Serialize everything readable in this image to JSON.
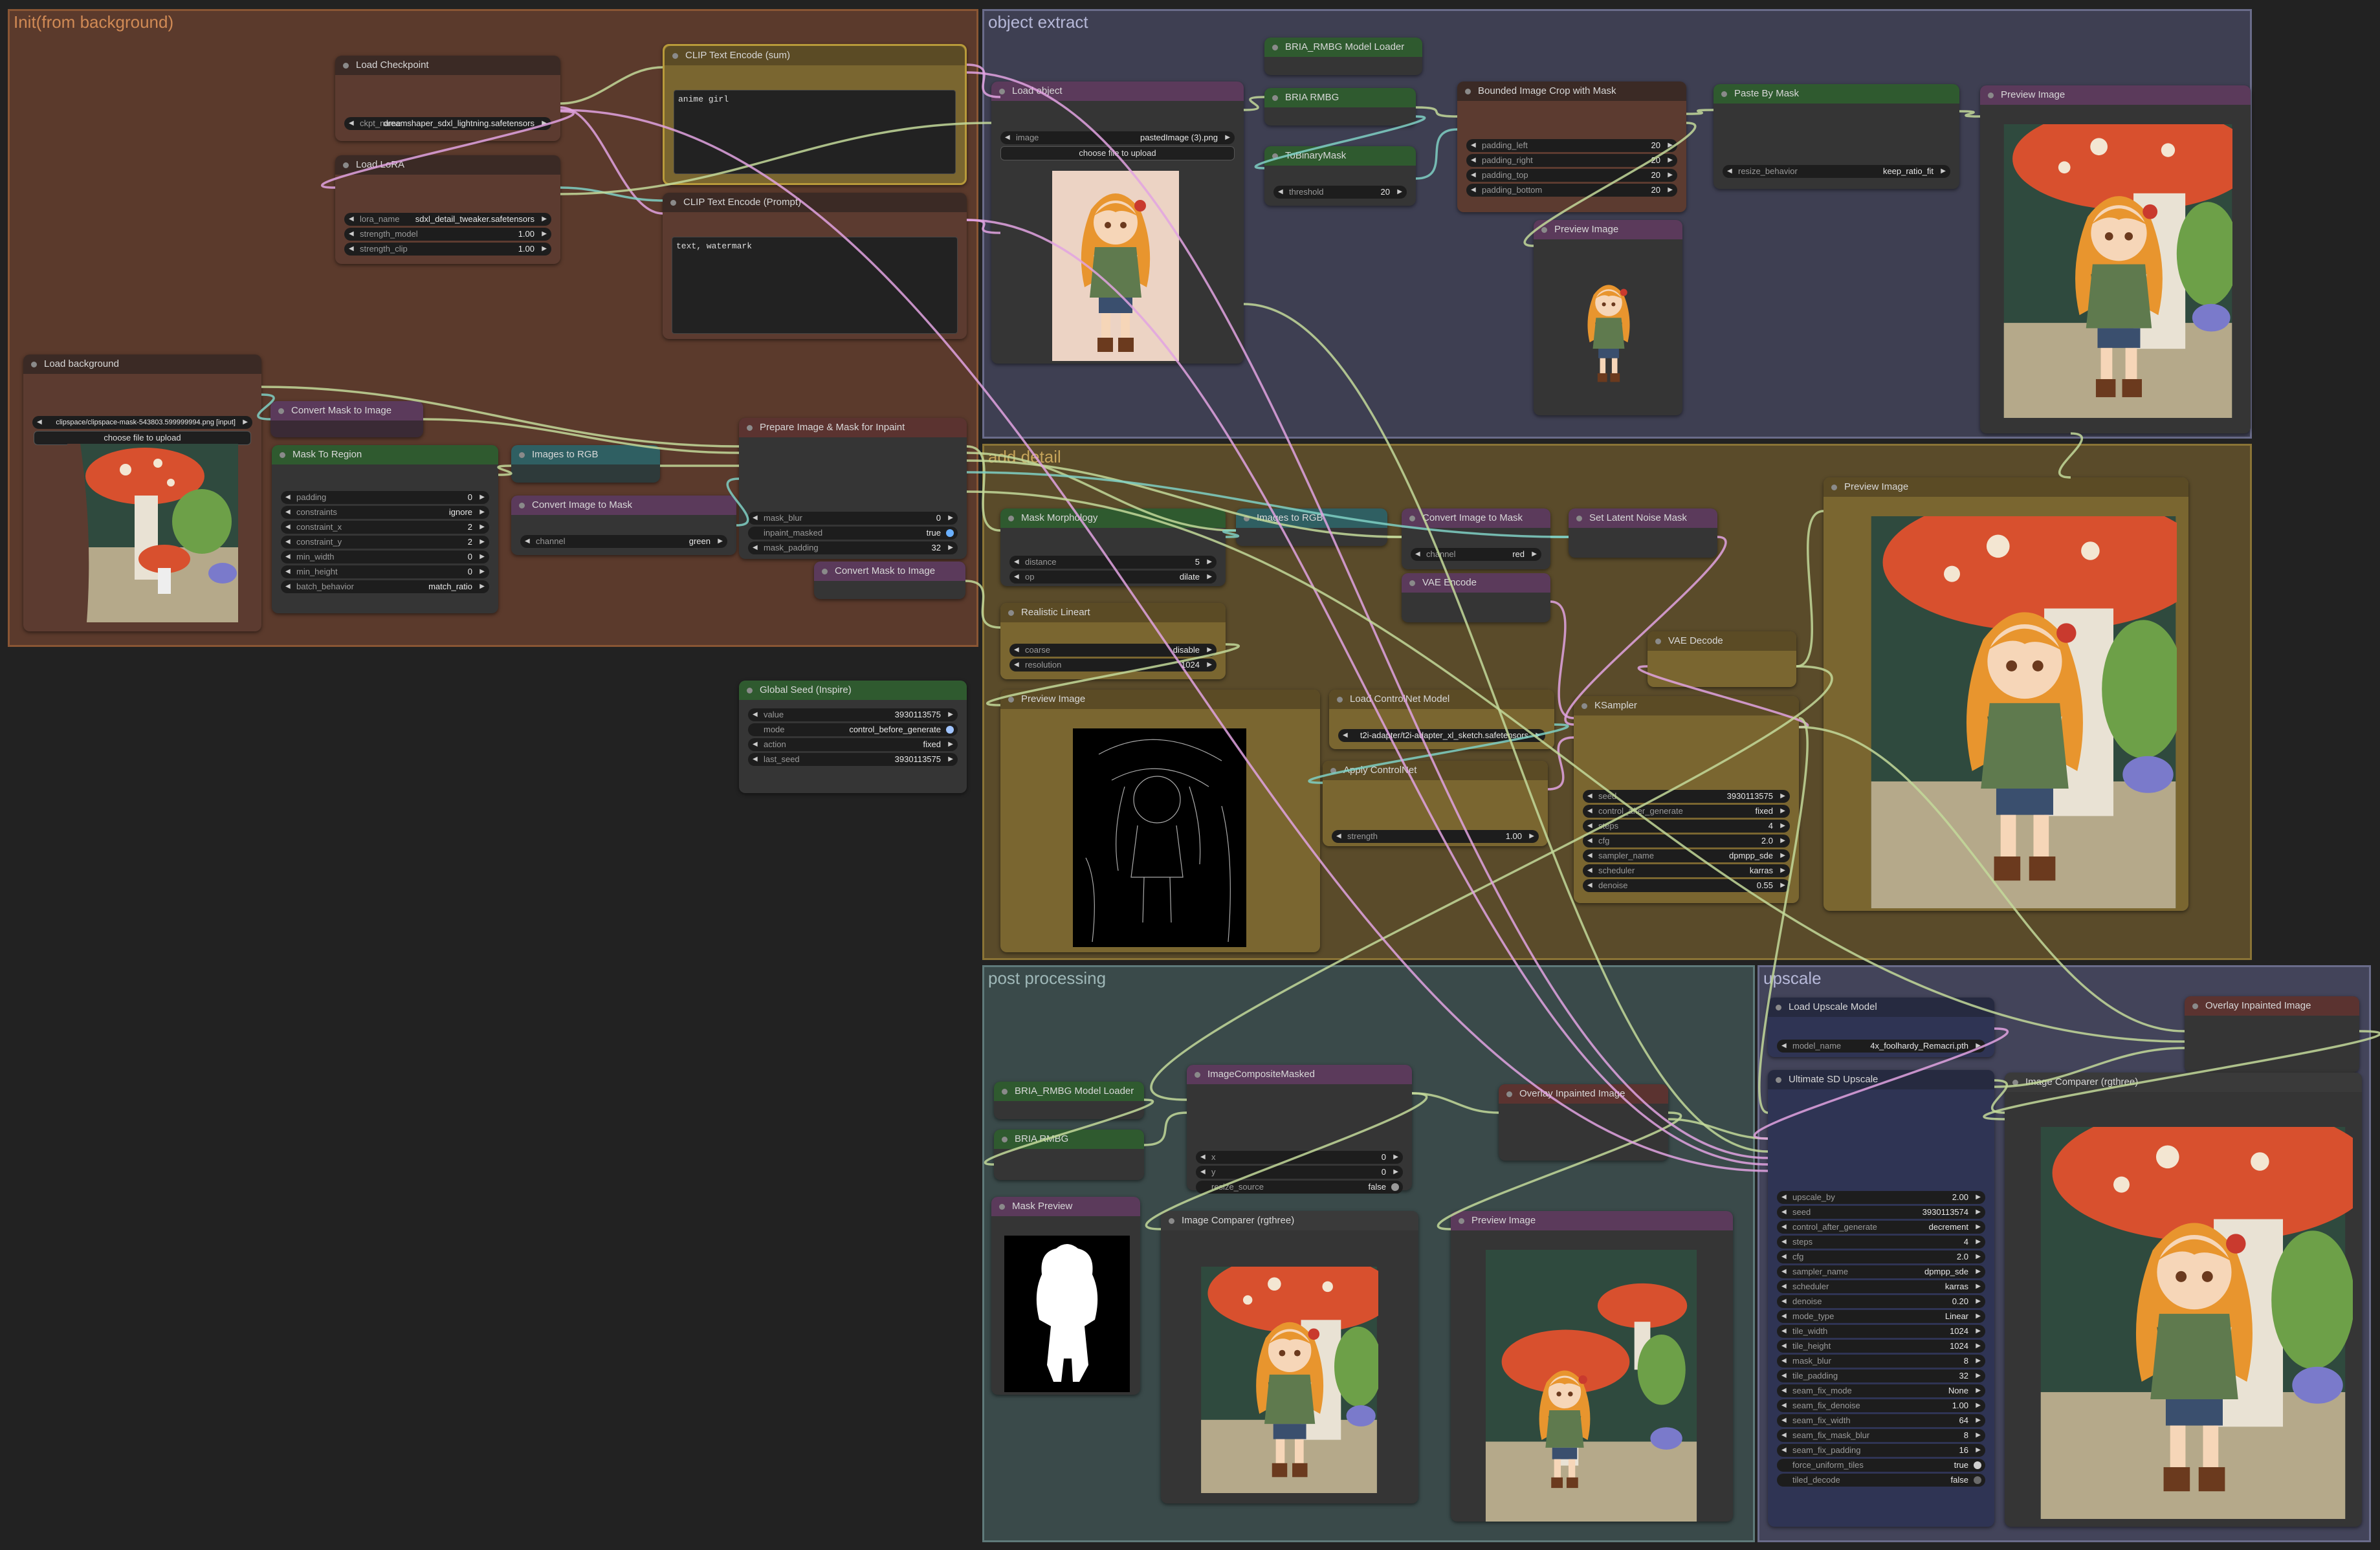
{
  "groups": {
    "init": "Init(from background)",
    "object_extract": "object extract",
    "add_detail": "add detail",
    "post_processing": "post processing",
    "upscale": "upscale"
  },
  "nodes": {
    "load_checkpoint": {
      "title": "Load Checkpoint",
      "ckpt_name_key": "ckpt_name",
      "ckpt_name": "dreamshaper_sdxl_lightning.safetensors"
    },
    "clip_sum": {
      "title": "CLIP Text Encode (sum)",
      "text": "anime girl"
    },
    "clip_prompt": {
      "title": "CLIP Text Encode (Prompt)",
      "text": "text, watermark"
    },
    "load_lora": {
      "title": "Load LoRA",
      "lora_name_key": "lora_name",
      "lora_name": "sdxl_detail_tweaker.safetensors",
      "strength_model_key": "strength_model",
      "strength_model": "1.00",
      "strength_clip_key": "strength_clip",
      "strength_clip": "1.00"
    },
    "load_background": {
      "title": "Load background",
      "image": "clipspace/clipspace-mask-543803.599999994.png [input]",
      "upload": "choose file to upload"
    },
    "convert_mask_to_image_1": {
      "title": "Convert Mask to Image"
    },
    "mask_to_region": {
      "title": "Mask To Region",
      "widgets": [
        [
          "padding",
          "0"
        ],
        [
          "constraints",
          "ignore"
        ],
        [
          "constraint_x",
          "2"
        ],
        [
          "constraint_y",
          "2"
        ],
        [
          "min_width",
          "0"
        ],
        [
          "min_height",
          "0"
        ],
        [
          "batch_behavior",
          "match_ratio"
        ]
      ]
    },
    "images_to_rgb_1": {
      "title": "Images to RGB"
    },
    "convert_image_to_mask_1": {
      "title": "Convert Image to Mask",
      "channel_key": "channel",
      "channel": "green"
    },
    "prepare_inpaint": {
      "title": "Prepare Image & Mask for Inpaint",
      "mask_blur_key": "mask_blur",
      "mask_blur": "0",
      "inpaint_masked_key": "inpaint_masked",
      "inpaint_masked": "true",
      "mask_padding_key": "mask_padding",
      "mask_padding": "32"
    },
    "convert_mask_to_image_2": {
      "title": "Convert Mask to Image"
    },
    "global_seed": {
      "title": "Global Seed (Inspire)",
      "widgets": [
        [
          "value",
          "3930113575"
        ],
        [
          "mode",
          "control_before_generate"
        ],
        [
          "action",
          "fixed"
        ],
        [
          "last_seed",
          "3930113575"
        ]
      ]
    },
    "load_object": {
      "title": "Load object",
      "image_key": "image",
      "image": "pastedImage (3).png",
      "upload": "choose file to upload"
    },
    "bria_loader_1": {
      "title": "BRIA_RMBG Model Loader"
    },
    "bria_rmbg_1": {
      "title": "BRIA RMBG"
    },
    "to_binary_mask": {
      "title": "ToBinaryMask",
      "threshold_key": "threshold",
      "threshold": "20"
    },
    "bounded_crop": {
      "title": "Bounded Image Crop with Mask",
      "widgets": [
        [
          "padding_left",
          "20"
        ],
        [
          "padding_right",
          "20"
        ],
        [
          "padding_top",
          "20"
        ],
        [
          "padding_bottom",
          "20"
        ]
      ]
    },
    "preview_crop": {
      "title": "Preview Image"
    },
    "paste_by_mask": {
      "title": "Paste By Mask",
      "resize_behavior_key": "resize_behavior",
      "resize_behavior": "keep_ratio_fit"
    },
    "preview_paste": {
      "title": "Preview Image"
    },
    "mask_morphology": {
      "title": "Mask Morphology",
      "distance_key": "distance",
      "distance": "5",
      "op_key": "op",
      "op": "dilate"
    },
    "images_to_rgb_2": {
      "title": "Images to RGB"
    },
    "convert_image_to_mask_2": {
      "title": "Convert Image to Mask",
      "channel_key": "channel",
      "channel": "red"
    },
    "set_latent_noise_mask": {
      "title": "Set Latent Noise Mask"
    },
    "vae_encode": {
      "title": "VAE Encode"
    },
    "realistic_lineart": {
      "title": "Realistic Lineart",
      "coarse_key": "coarse",
      "coarse": "disable",
      "resolution_key": "resolution",
      "resolution": "1024"
    },
    "preview_lineart": {
      "title": "Preview Image"
    },
    "load_controlnet": {
      "title": "Load ControlNet Model",
      "control_net_name": "t2i-adapter/t2i-adapter_xl_sketch.safetensors"
    },
    "apply_controlnet": {
      "title": "Apply ControlNet",
      "strength_key": "strength",
      "strength": "1.00"
    },
    "vae_decode": {
      "title": "VAE Decode"
    },
    "ksampler": {
      "title": "KSampler",
      "widgets": [
        [
          "seed",
          "3930113575"
        ],
        [
          "control_after_generate",
          "fixed"
        ],
        [
          "steps",
          "4"
        ],
        [
          "cfg",
          "2.0"
        ],
        [
          "sampler_name",
          "dpmpp_sde"
        ],
        [
          "scheduler",
          "karras"
        ],
        [
          "denoise",
          "0.55"
        ]
      ]
    },
    "preview_detail": {
      "title": "Preview Image"
    },
    "bria_loader_2": {
      "title": "BRIA_RMBG Model Loader"
    },
    "bria_rmbg_2": {
      "title": "BRIA RMBG"
    },
    "mask_preview": {
      "title": "Mask Preview"
    },
    "image_composite": {
      "title": "ImageCompositeMasked",
      "x_key": "x",
      "x": "0",
      "y_key": "y",
      "y": "0",
      "resize_source_key": "resize_source",
      "resize_source": "false"
    },
    "image_comparer_1": {
      "title": "Image Comparer (rgthree)"
    },
    "overlay_1": {
      "title": "Overlay Inpainted Image"
    },
    "preview_post": {
      "title": "Preview Image"
    },
    "load_upscale_model": {
      "title": "Load Upscale Model",
      "model_name_key": "model_name",
      "model_name": "4x_foolhardy_Remacri.pth"
    },
    "ultimate_sd_upscale": {
      "title": "Ultimate SD Upscale",
      "widgets": [
        [
          "upscale_by",
          "2.00"
        ],
        [
          "seed",
          "3930113574"
        ],
        [
          "control_after_generate",
          "decrement"
        ],
        [
          "steps",
          "4"
        ],
        [
          "cfg",
          "2.0"
        ],
        [
          "sampler_name",
          "dpmpp_sde"
        ],
        [
          "scheduler",
          "karras"
        ],
        [
          "denoise",
          "0.20"
        ],
        [
          "mode_type",
          "Linear"
        ],
        [
          "tile_width",
          "1024"
        ],
        [
          "tile_height",
          "1024"
        ],
        [
          "mask_blur",
          "8"
        ],
        [
          "tile_padding",
          "32"
        ],
        [
          "seam_fix_mode",
          "None"
        ],
        [
          "seam_fix_denoise",
          "1.00"
        ],
        [
          "seam_fix_width",
          "64"
        ],
        [
          "seam_fix_mask_blur",
          "8"
        ],
        [
          "seam_fix_padding",
          "16"
        ]
      ],
      "force_uniform_tiles_key": "force_uniform_tiles",
      "force_uniform_tiles": "true",
      "tiled_decode_key": "tiled_decode",
      "tiled_decode": "false"
    },
    "overlay_2": {
      "title": "Overlay Inpainted Image"
    },
    "image_comparer_2": {
      "title": "Image Comparer (rgthree)"
    }
  },
  "colors": {
    "init_group": "#5b3a2c",
    "object_group": "#3e3f52",
    "detail_group": "#5a4b2a",
    "post_group": "#3a4a4a",
    "upscale_group": "#43445a",
    "wire_green": "#c3d99a",
    "wire_pink": "#e2a3e2",
    "wire_teal": "#7fd0c4"
  }
}
